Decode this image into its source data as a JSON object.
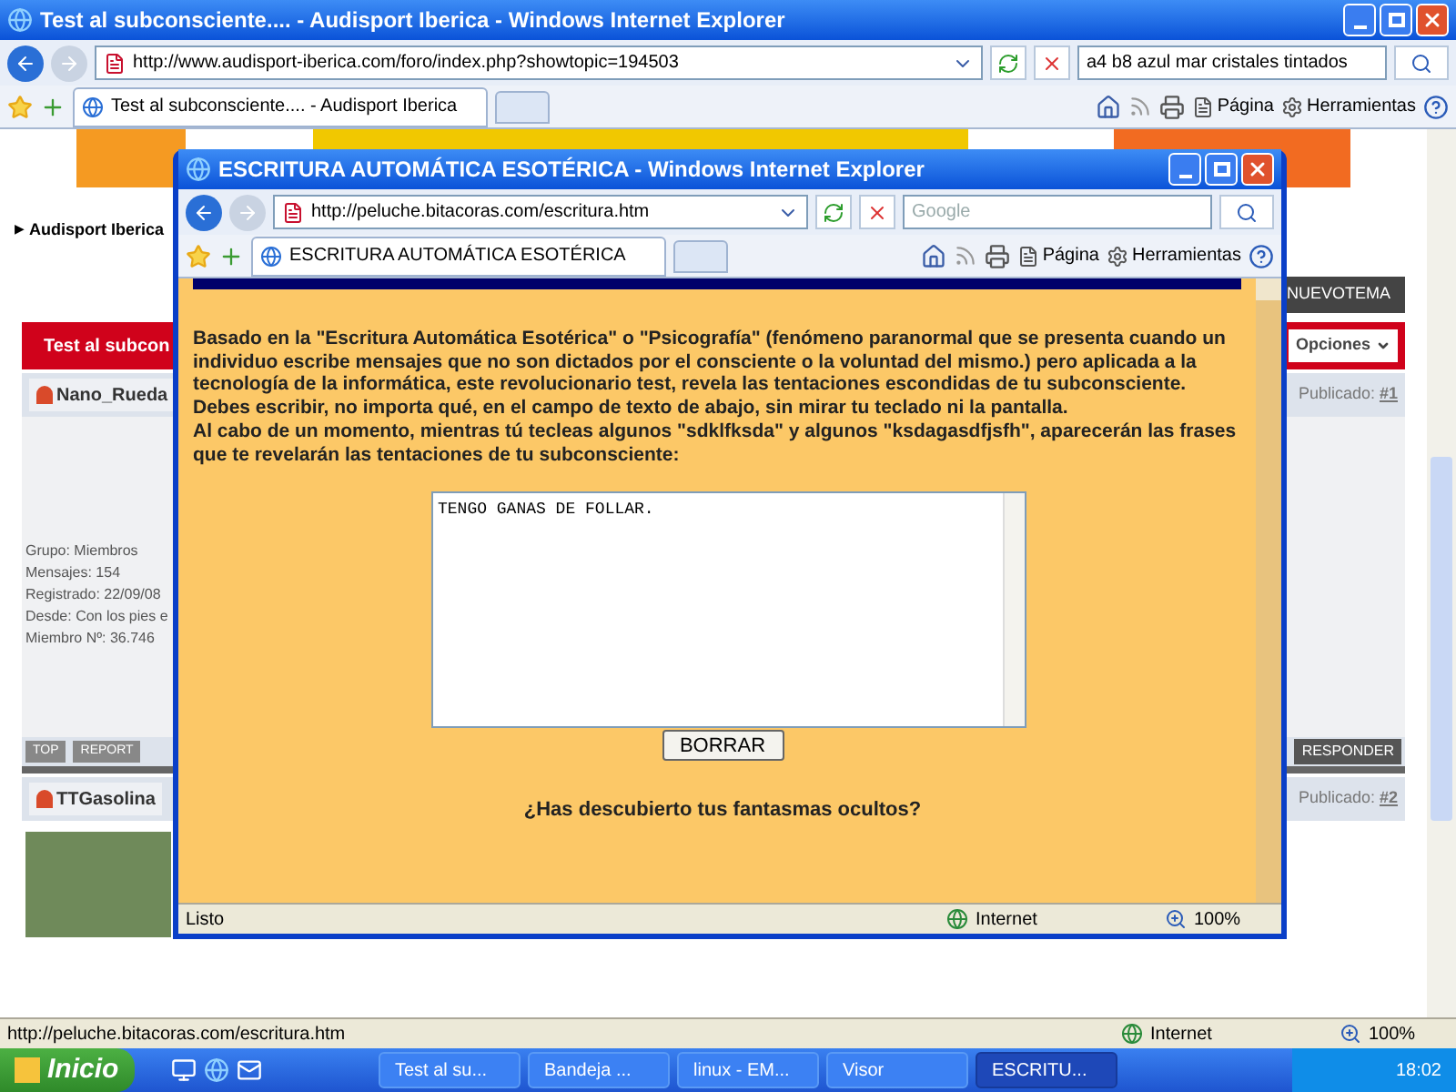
{
  "main_window": {
    "title": "Test al subconsciente.... - Audisport Iberica - Windows Internet Explorer",
    "address": "http://www.audisport-iberica.com/foro/index.php?showtopic=194503",
    "search": "a4 b8 azul mar cristales tintados",
    "tab": "Test al subconsciente.... - Audisport Iberica",
    "toolbar": [
      "Página",
      "Herramientas"
    ],
    "status_url": "http://peluche.bitacoras.com/escritura.htm",
    "zone": "Internet",
    "zoom": "100%"
  },
  "forum": {
    "breadcrumb_marker": "▶",
    "breadcrumb": "Audisport Iberica",
    "new_topic": "NUEVOTEMA",
    "topic_title": "Test al subcon",
    "options": "Opciones",
    "posts": [
      {
        "user": "Nano_Rueda",
        "published_label": "Publicado:",
        "post_number": "#1",
        "info": [
          "Grupo: Miembros",
          "Mensajes: 154",
          "Registrado: 22/09/08",
          "Desde: Con los pies e",
          "Miembro Nº: 36.746"
        ],
        "photo": false
      },
      {
        "user": "TTGasolina",
        "published_label": "Publicado:",
        "post_number": "#2",
        "photo": true
      }
    ],
    "post_buttons": [
      "TOP",
      "REPORT"
    ],
    "reply": "RESPONDER"
  },
  "popup": {
    "title": "ESCRITURA AUTOMÁTICA ESOTÉRICA - Windows Internet Explorer",
    "address": "http://peluche.bitacoras.com/escritura.htm",
    "search_placeholder": "Google",
    "tab": "ESCRITURA AUTOMÁTICA ESOTÉRICA",
    "toolbar": [
      "Página",
      "Herramientas"
    ],
    "paragraphs": [
      "Basado en la \"Escritura Automática Esotérica\" o \"Psicografía\" (fenómeno paranormal que se presenta cuando un individuo escribe mensajes que no son dictados por el consciente o la voluntad del mismo.) pero aplicada a la tecnología de la informática, este revolucionario test, revela las tentaciones escondidas de tu subconsciente.",
      "Debes escribir, no importa qué, en el campo de texto de abajo, sin mirar tu teclado ni la pantalla.",
      "Al cabo de un momento, mientras tú tecleas algunos \"sdklfksda\" y algunos \"ksdagasdfjsfh\", aparecerán las frases que te revelarán las tentaciones de tu subconsciente:"
    ],
    "textarea": "TENGO GANAS DE FOLLAR.",
    "button": "BORRAR",
    "question": "¿Has descubierto tus fantasmas ocultos?",
    "status": "Listo",
    "zone": "Internet",
    "zoom": "100%"
  },
  "taskbar": {
    "start": "Inicio",
    "tasks": [
      {
        "label": "Test al su...",
        "selected": false
      },
      {
        "label": "Bandeja ...",
        "selected": false
      },
      {
        "label": "linux - EM...",
        "selected": false
      },
      {
        "label": "Visor",
        "selected": false
      },
      {
        "label": "ESCRITU...",
        "selected": true
      }
    ],
    "clock": "18:02"
  }
}
